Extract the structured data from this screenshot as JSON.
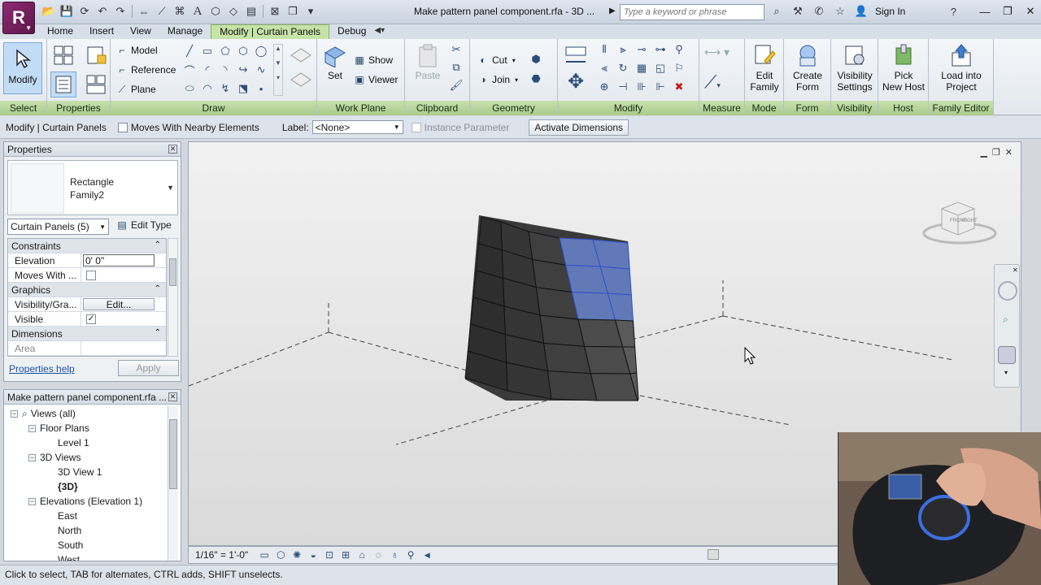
{
  "app": {
    "logo_letter": "R",
    "title": "Make pattern panel component.rfa - 3D ...",
    "search_placeholder": "Type a keyword or phrase",
    "sign_in": "Sign In"
  },
  "tabs": [
    "Home",
    "Insert",
    "View",
    "Manage",
    "Modify | Curtain Panels",
    "Debug"
  ],
  "active_tab_index": 4,
  "ribbon": {
    "select": {
      "title": "Select",
      "modify_label": "Modify"
    },
    "properties": {
      "title": "Properties"
    },
    "draw": {
      "title": "Draw",
      "model": "Model",
      "reference": "Reference",
      "plane": "Plane"
    },
    "work_plane": {
      "title": "Work Plane",
      "set": "Set",
      "show": "Show",
      "viewer": "Viewer"
    },
    "clipboard": {
      "title": "Clipboard",
      "paste": "Paste"
    },
    "geometry": {
      "title": "Geometry",
      "cut": "Cut",
      "join": "Join"
    },
    "modify": {
      "title": "Modify"
    },
    "measure": {
      "title": "Measure"
    },
    "mode": {
      "title": "Mode",
      "edit_family_1": "Edit",
      "edit_family_2": "Family"
    },
    "form": {
      "title": "Form",
      "create_form_1": "Create",
      "create_form_2": "Form"
    },
    "visibility": {
      "title": "Visibility",
      "vis_1": "Visibility",
      "vis_2": "Settings"
    },
    "host": {
      "title": "Host",
      "pick_1": "Pick",
      "pick_2": "New Host"
    },
    "family_editor": {
      "title": "Family Editor",
      "load_1": "Load into",
      "load_2": "Project"
    }
  },
  "options_bar": {
    "context": "Modify | Curtain Panels",
    "moves_with": "Moves With Nearby Elements",
    "label_caption": "Label:",
    "label_value": "<None>",
    "instance_param": "Instance Parameter",
    "activate_dims": "Activate Dimensions"
  },
  "properties_palette": {
    "title": "Properties",
    "type_name_1": "Rectangle",
    "type_name_2": "Family2",
    "filter": "Curtain Panels (5)",
    "edit_type": "Edit Type",
    "groups": {
      "constraints": "Constraints",
      "graphics": "Graphics",
      "dimensions": "Dimensions"
    },
    "rows": {
      "elevation_label": "Elevation",
      "elevation_value": "0'  0\"",
      "moves_with_label": "Moves With ...",
      "vis_label": "Visibility/Gra...",
      "vis_button": "Edit...",
      "visible_label": "Visible",
      "area_label": "Area"
    },
    "help_link": "Properties help",
    "apply": "Apply"
  },
  "project_browser": {
    "title": "Make pattern panel component.rfa ...",
    "nodes": [
      {
        "label": "Views (all)",
        "level": 0,
        "box": "-"
      },
      {
        "label": "Floor Plans",
        "level": 1,
        "box": "-"
      },
      {
        "label": "Level 1",
        "level": 2,
        "box": ""
      },
      {
        "label": "3D Views",
        "level": 1,
        "box": "-"
      },
      {
        "label": "3D View 1",
        "level": 2,
        "box": ""
      },
      {
        "label": "{3D}",
        "level": 2,
        "box": "",
        "bold": true
      },
      {
        "label": "Elevations (Elevation 1)",
        "level": 1,
        "box": "-"
      },
      {
        "label": "East",
        "level": 2,
        "box": ""
      },
      {
        "label": "North",
        "level": 2,
        "box": ""
      },
      {
        "label": "South",
        "level": 2,
        "box": ""
      },
      {
        "label": "West",
        "level": 2,
        "box": ""
      }
    ]
  },
  "view": {
    "scale": "1/16\" = 1'-0\"",
    "viewcube_front": "FRONT",
    "viewcube_right": "RIGHT"
  },
  "status": "Click to select, TAB for alternates, CTRL adds, SHIFT unselects.",
  "colors": {
    "ribbon_green": "#a9cb89",
    "selection_blue": "#6f8fe0",
    "panel_dark": "#3a3a3a"
  }
}
